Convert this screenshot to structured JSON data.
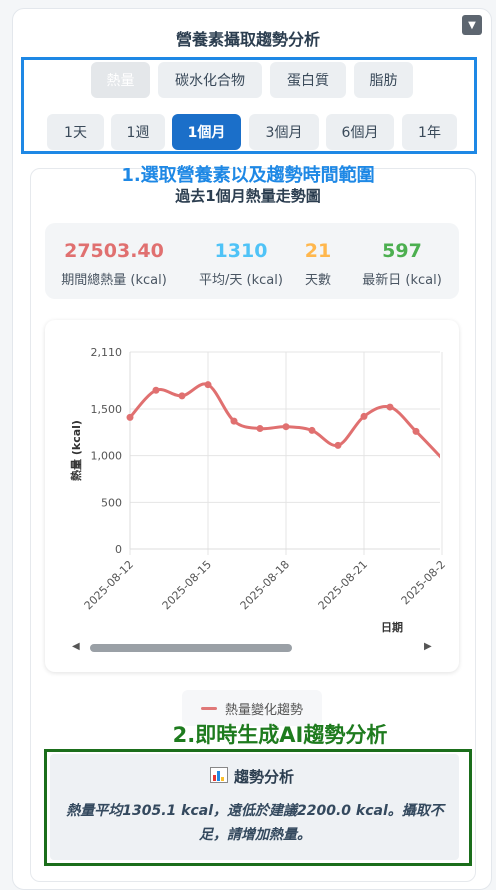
{
  "title": "營養素攝取趨勢分析",
  "collapse_icon": "triangle-down-icon",
  "nutrient_tabs": [
    {
      "label": "熱量",
      "state": "disabled"
    },
    {
      "label": "碳水化合物",
      "state": "normal"
    },
    {
      "label": "蛋白質",
      "state": "normal"
    },
    {
      "label": "脂肪",
      "state": "normal"
    }
  ],
  "range_tabs": [
    {
      "label": "1天",
      "state": "normal"
    },
    {
      "label": "1週",
      "state": "normal"
    },
    {
      "label": "1個月",
      "state": "active"
    },
    {
      "label": "3個月",
      "state": "normal"
    },
    {
      "label": "6個月",
      "state": "normal"
    },
    {
      "label": "1年",
      "state": "normal"
    }
  ],
  "annotation_1": "1.選取營養素以及趨勢時間範圍",
  "subtitle": "過去1個月熱量走勢圖",
  "stats": [
    {
      "value": "27503.40",
      "label": "期間總熱量 (kcal)",
      "color": "#e07070"
    },
    {
      "value": "1310",
      "label": "平均/天 (kcal)",
      "color": "#4fc3f7"
    },
    {
      "value": "21",
      "label": "天數",
      "color": "#ffb74d"
    },
    {
      "value": "597",
      "label": "最新日 (kcal)",
      "color": "#4caf50"
    }
  ],
  "chart_data": {
    "type": "line",
    "ylabel": "熱量 (kcal)",
    "xlabel": "日期",
    "ylim": [
      0,
      2110
    ],
    "y_ticks": [
      "0",
      "500",
      "1,000",
      "1,500",
      "2,110"
    ],
    "y_tick_values": [
      0,
      500,
      1000,
      1500,
      2110
    ],
    "x_ticks": [
      "2025-08-12",
      "2025-08-15",
      "2025-08-18",
      "2025-08-21",
      "2025-08-2"
    ],
    "series": [
      {
        "name": "熱量變化趨勢",
        "color": "#e07070",
        "x": [
          "2025-08-12",
          "2025-08-13",
          "2025-08-14",
          "2025-08-15",
          "2025-08-16",
          "2025-08-17",
          "2025-08-18",
          "2025-08-19",
          "2025-08-20",
          "2025-08-21",
          "2025-08-22",
          "2025-08-23",
          "2025-08-24"
        ],
        "values": [
          1410,
          1700,
          1640,
          1760,
          1370,
          1290,
          1310,
          1270,
          1110,
          1420,
          1520,
          1260,
          970
        ]
      }
    ],
    "grid": true,
    "legend": "bottom"
  },
  "legend_label": "熱量變化趨勢",
  "annotation_2": "2.即時生成AI趨勢分析",
  "ai_card": {
    "icon": "bar-chart-icon",
    "title": "趨勢分析",
    "text": "熱量平均1305.1 kcal，遠低於建議2200.0 kcal。攝取不足，請增加熱量。"
  }
}
